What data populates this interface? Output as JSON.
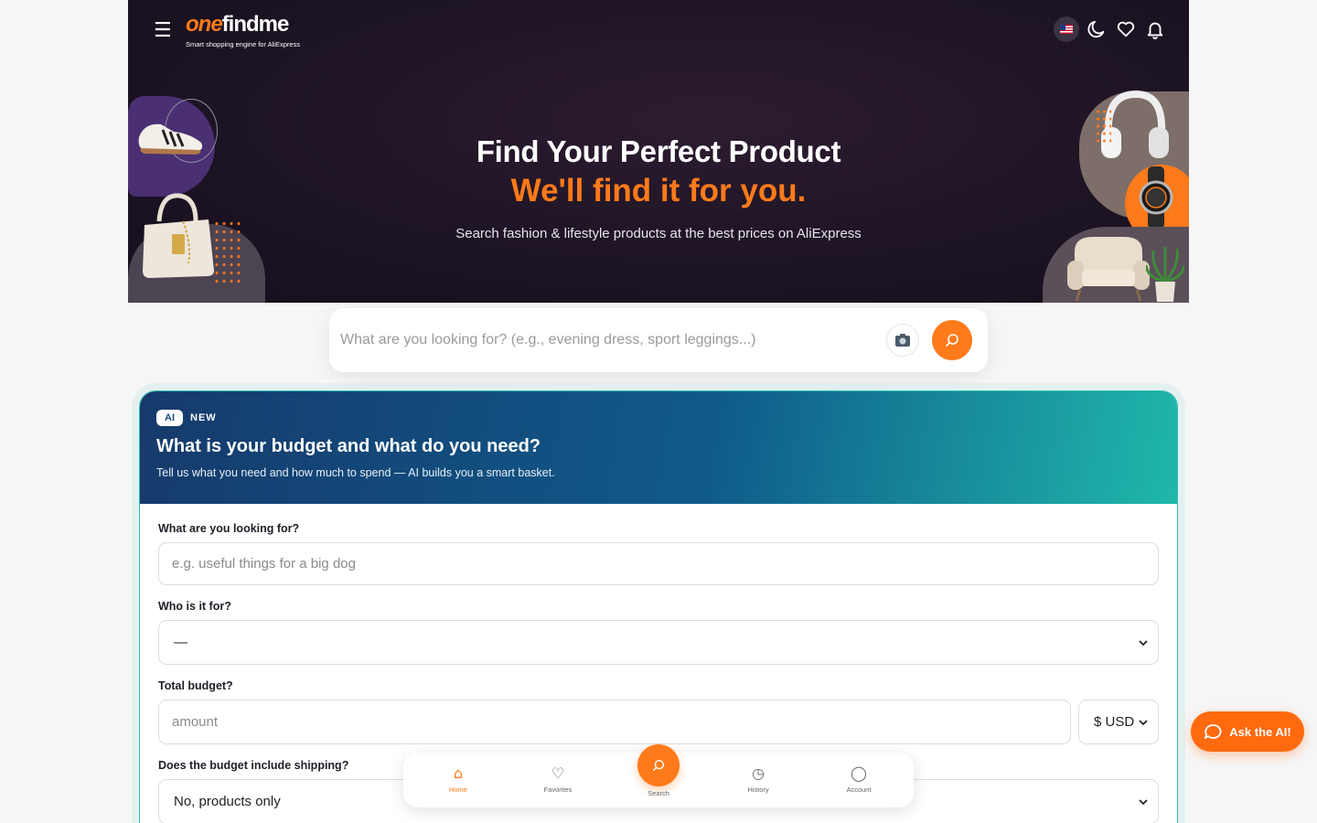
{
  "brand": {
    "name_part1": "one",
    "name_part2": "findme",
    "tagline": "Smart shopping engine for AliExpress",
    "accent_color": "#ff7a1a"
  },
  "header": {
    "menu_icon": "menu-icon",
    "language_flag": "us-flag-icon",
    "icons": [
      "moon-icon",
      "heart-icon",
      "bell-icon"
    ]
  },
  "hero": {
    "title": "Find Your Perfect Product",
    "accent": "We'll find it for you.",
    "subtitle": "Search fashion & lifestyle products at the best prices on AliExpress"
  },
  "search": {
    "placeholder": "What are you looking for? (e.g., evening dress, sport leggings...)",
    "camera_icon": "camera-icon",
    "submit_icon": "search-icon"
  },
  "ai_card": {
    "badge": "AI",
    "new_label": "NEW",
    "title": "What is your budget and what do you need?",
    "subtitle": "Tell us what you need and how much to spend — AI builds you a smart basket.",
    "fields": {
      "looking_for_label": "What are you looking for?",
      "looking_for_placeholder": "e.g. useful things for a big dog",
      "who_label": "Who is it for?",
      "who_value": "—",
      "budget_label": "Total budget?",
      "budget_placeholder": "amount",
      "currency_value": "$ USD",
      "shipping_label": "Does the budget include shipping?",
      "shipping_value": "No, products only"
    }
  },
  "bottom_nav": {
    "items": [
      {
        "label": "Home",
        "icon": "home-icon",
        "active": true
      },
      {
        "label": "Favorites",
        "icon": "heart-icon"
      },
      {
        "label": "Search",
        "icon": "search-icon"
      },
      {
        "label": "History",
        "icon": "clock-icon"
      },
      {
        "label": "Account",
        "icon": "user-icon"
      }
    ]
  },
  "ask_ai": {
    "label": "Ask the AI!",
    "icon": "chat-icon"
  }
}
